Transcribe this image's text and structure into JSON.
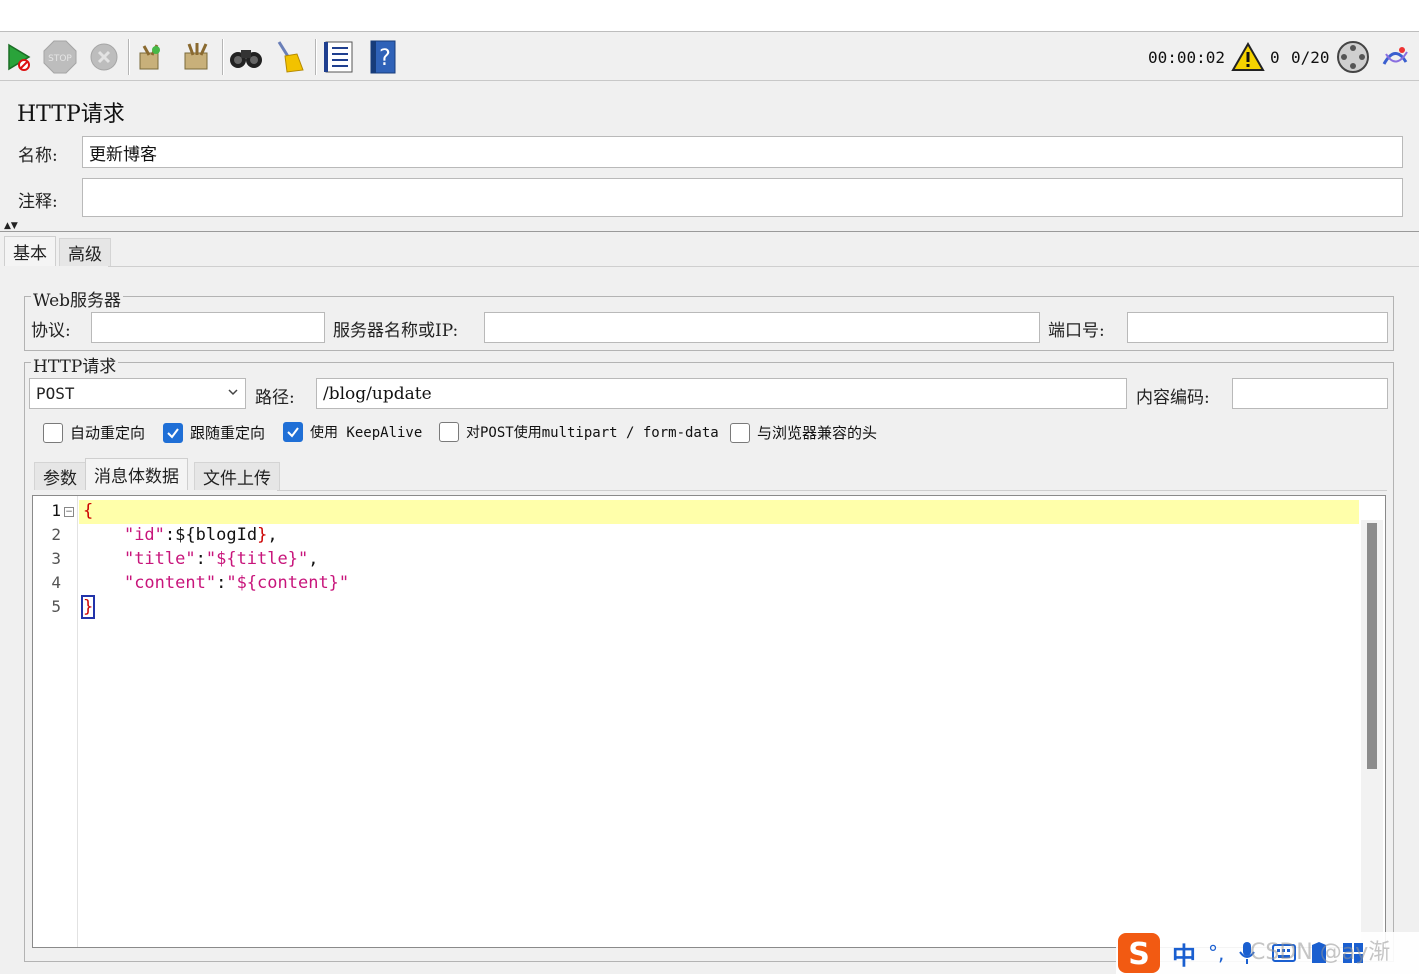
{
  "toolbar": {
    "icons": [
      "start-no-pause-icon",
      "stop-icon",
      "shutdown-icon",
      "clear-icon",
      "clear-all-icon",
      "search-icon",
      "reset-search-icon",
      "function-helper-icon",
      "help-icon"
    ],
    "timer": "00:00:02",
    "warning_count": "0",
    "threads": "0/20"
  },
  "panel": {
    "title": "HTTP请求",
    "name_label": "名称:",
    "name_value": "更新博客",
    "comment_label": "注释:",
    "comment_value": ""
  },
  "tabs": {
    "basic": "基本",
    "advanced": "高级"
  },
  "web_server": {
    "legend": "Web服务器",
    "protocol_label": "协议:",
    "protocol_value": "",
    "server_label": "服务器名称或IP:",
    "server_value": "",
    "port_label": "端口号:",
    "port_value": ""
  },
  "http_request": {
    "legend": "HTTP请求",
    "method": "POST",
    "path_label": "路径:",
    "path_value": "/blog/update",
    "encoding_label": "内容编码:",
    "encoding_value": ""
  },
  "options": [
    {
      "label": "自动重定向",
      "checked": false
    },
    {
      "label": "跟随重定向",
      "checked": true
    },
    {
      "label": "使用 KeepAlive",
      "checked": true
    },
    {
      "label": "对POST使用multipart / form-data",
      "checked": false
    },
    {
      "label": "与浏览器兼容的头",
      "checked": false
    }
  ],
  "subtabs": {
    "params": "参数",
    "body": "消息体数据",
    "files": "文件上传"
  },
  "editor": {
    "line_numbers": [
      "1",
      "2",
      "3",
      "4",
      "5"
    ],
    "lines": [
      {
        "indent": "",
        "open": "{"
      },
      {
        "key": "\"id\"",
        "colon": ":",
        "val_plain": "${",
        "val_str": "blogId",
        "close": "}",
        "comma": ","
      },
      {
        "key": "\"title\"",
        "colon": ":",
        "val_str": "\"${title}\"",
        "comma": ","
      },
      {
        "key": "\"content\"",
        "colon": ":",
        "val_str": "\"${content}\""
      },
      {
        "indent": "",
        "close": "}"
      }
    ]
  },
  "ime": {
    "mode": "中",
    "punct": "°,"
  },
  "watermark": "CSDN @ay渐"
}
